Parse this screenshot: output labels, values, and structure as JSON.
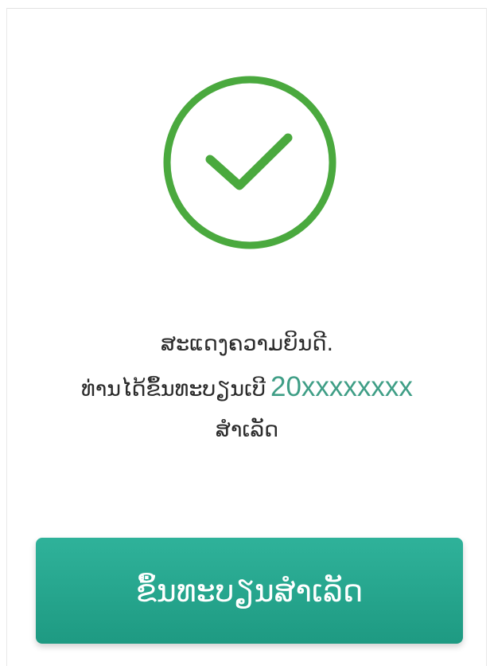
{
  "result": {
    "icon": "check-circle-icon",
    "icon_color": "#4aa93e",
    "line1": "ສະແດງຄວາມຍິນດີ.",
    "line2_prefix": "ທ່ານໄດ້ຂຶ້ນທະບຽນເບີ",
    "phone": "20xxxxxxxx",
    "line3": "ສຳເລັດ",
    "phone_color": "#3f9e86"
  },
  "button": {
    "label": "ຂຶ້ນທະບຽນສຳເລັດ",
    "color": "#23a58c"
  }
}
